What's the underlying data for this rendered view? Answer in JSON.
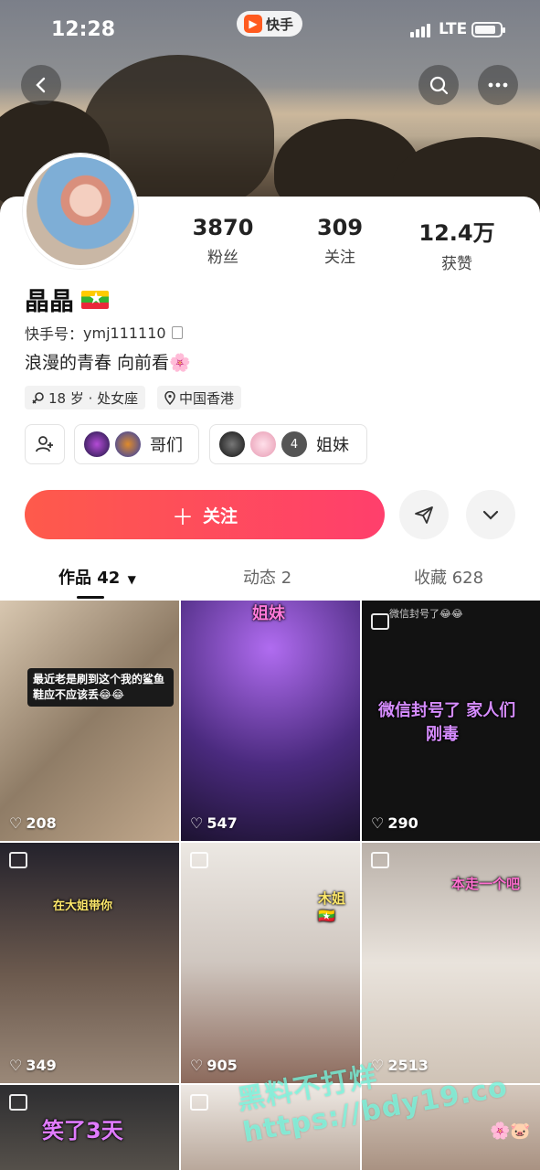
{
  "status_bar": {
    "time": "12:28",
    "app_badge": "快手",
    "network": "LTE",
    "battery_level": 0.85
  },
  "profile": {
    "name": "晶晶",
    "kuaishou_id_label": "快手号：",
    "kuaishou_id": "ymj111110",
    "bio": "浪漫的青春 向前看🌸",
    "age_sign": "18 岁 · 处女座",
    "location": "中国香港"
  },
  "stats": [
    {
      "value": "3870",
      "label": "粉丝"
    },
    {
      "value": "309",
      "label": "关注"
    },
    {
      "value": "12.4万",
      "label": "获赞"
    }
  ],
  "groups": [
    {
      "label": "哥们",
      "avatar_colors": [
        "#3b2a8c",
        "#6a3fd8"
      ]
    },
    {
      "label": "姐妹",
      "avatar_colors": [
        "#2a2a2a",
        "#f2b9c8",
        "#444444"
      ],
      "extra_count": "4"
    }
  ],
  "actions": {
    "follow": "关注"
  },
  "tabs": [
    {
      "label": "作品 42",
      "active": true
    },
    {
      "label": "动态 2",
      "active": false
    },
    {
      "label": "收藏 628",
      "active": false
    }
  ],
  "posts": [
    {
      "likes": "208",
      "caption": "最近老是刷到这个我的鲨鱼鞋应不应该丢😂😂",
      "bg": "#c9b8a2"
    },
    {
      "likes": "547",
      "caption": "姐妹",
      "bg": "#5b3a8e"
    },
    {
      "likes": "290",
      "caption": "微信封号了 家人们",
      "caption2": "刚毒",
      "top_text": "微信封号了😂😂",
      "bg": "#121212"
    },
    {
      "likes": "349",
      "caption": "在大姐带你",
      "bg": "#2b2a33"
    },
    {
      "likes": "905",
      "caption": "木姐🇲🇲",
      "bg": "#d9d4cf"
    },
    {
      "likes": "2513",
      "caption": "本走一个吧",
      "bg": "#b9b0a8"
    },
    {
      "likes": "",
      "caption": "笑了3天",
      "bg": "#3a3a3a"
    },
    {
      "likes": "",
      "caption": "",
      "bg": "#e6e0da"
    },
    {
      "likes": "",
      "caption": "🌸🐷",
      "bg": "#d5c8bd"
    }
  ],
  "watermark": "黑料不打烊 https://bdy19.co",
  "colors": {
    "accent": "#fe4a5a"
  }
}
